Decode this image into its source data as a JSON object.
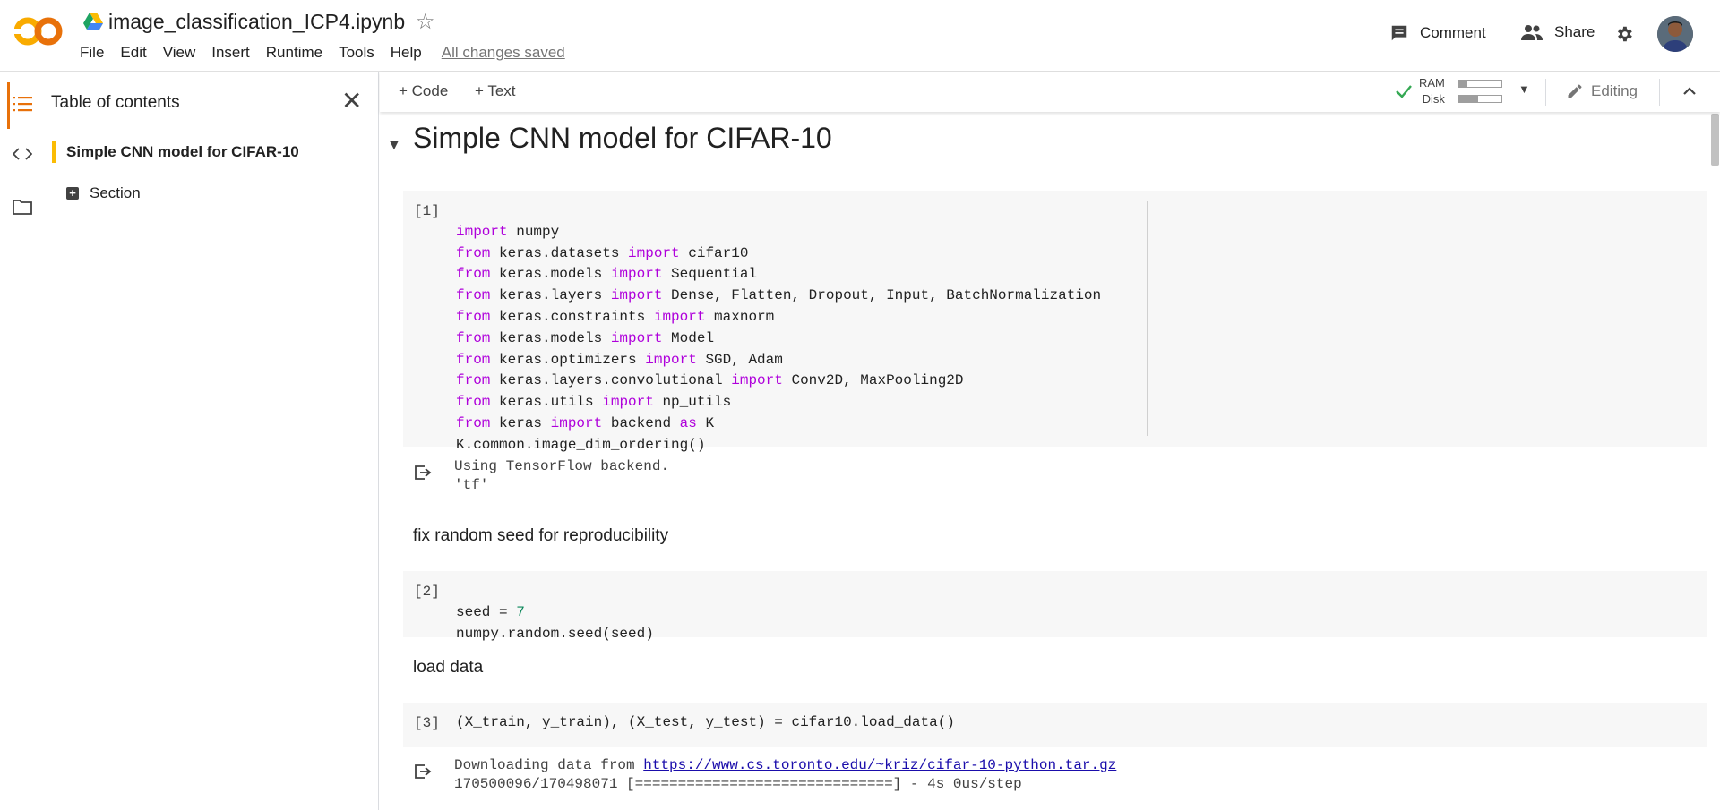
{
  "header": {
    "filename": "image_classification_ICP4.ipynb",
    "menu": [
      "File",
      "Edit",
      "View",
      "Insert",
      "Runtime",
      "Tools",
      "Help"
    ],
    "save_status": "All changes saved",
    "comment_label": "Comment",
    "share_label": "Share"
  },
  "toc": {
    "title": "Table of contents",
    "items": [
      {
        "label": "Simple CNN model for CIFAR-10"
      },
      {
        "label": "Section"
      }
    ]
  },
  "toolbar": {
    "add_code": "+ Code",
    "add_text": "+ Text",
    "ram_label": "RAM",
    "disk_label": "Disk",
    "ram_usage": 0.2,
    "disk_usage": 0.45,
    "editing_label": "Editing"
  },
  "notebook": {
    "section_title": "Simple CNN model for CIFAR-10",
    "cells": [
      {
        "number": "[1]",
        "lines": [
          "import numpy",
          "from keras.datasets import cifar10",
          "from keras.models import Sequential",
          "from keras.layers import Dense, Flatten, Dropout, Input, BatchNormalization",
          "from keras.constraints import maxnorm",
          "from keras.models import Model",
          "from keras.optimizers import SGD, Adam",
          "from keras.layers.convolutional import Conv2D, MaxPooling2D",
          "from keras.utils import np_utils",
          "from keras import backend as K",
          "K.common.image_dim_ordering()"
        ],
        "output": [
          "Using TensorFlow backend.",
          "'tf'"
        ]
      },
      {
        "markdown": "fix random seed for reproducibility"
      },
      {
        "number": "[2]",
        "lines": [
          "seed = 7",
          "numpy.random.seed(seed)"
        ]
      },
      {
        "markdown": "load data"
      },
      {
        "number": "[3]",
        "lines": [
          "(X_train, y_train), (X_test, y_test) = cifar10.load_data()"
        ],
        "output_prefix": "Downloading data from ",
        "output_link": "https://www.cs.toronto.edu/~kriz/cifar-10-python.tar.gz",
        "output_line2": "170500096/170498071 [==============================] - 4s 0us/step"
      }
    ]
  },
  "colors": {
    "accent": "#e8710a",
    "toc_marker": "#fbbc04",
    "keyword": "#af00db",
    "number": "#098658",
    "check": "#34a853"
  },
  "icons": [
    "colab-logo",
    "drive-icon",
    "star-icon",
    "comment-icon",
    "share-icon",
    "gear-icon",
    "avatar",
    "toc-icon",
    "code-icon",
    "folder-icon",
    "close-icon",
    "check-icon",
    "chevron-down-icon",
    "pencil-icon",
    "chevron-up-icon",
    "output-icon"
  ]
}
